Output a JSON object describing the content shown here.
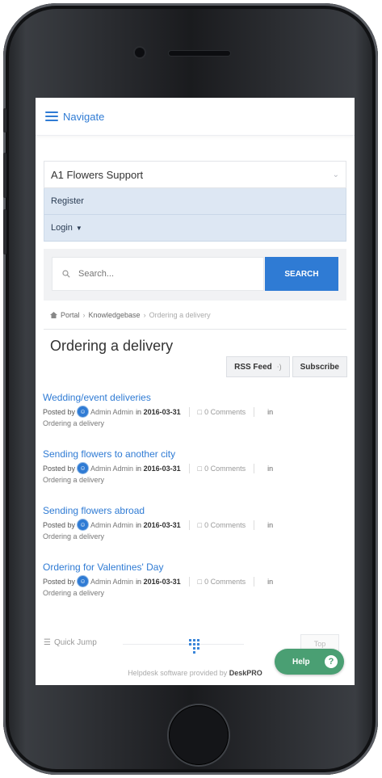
{
  "nav": {
    "label": "Navigate"
  },
  "menu": {
    "title": "A1 Flowers Support",
    "items": [
      {
        "label": "Register"
      },
      {
        "label": "Login"
      }
    ]
  },
  "search": {
    "placeholder": "Search...",
    "button_label": "SEARCH"
  },
  "breadcrumb": {
    "items": [
      "Portal",
      "Knowledgebase",
      "Ordering a delivery"
    ],
    "separator": "›"
  },
  "page": {
    "title": "Ordering a delivery"
  },
  "actions": {
    "rss_label": "RSS Feed",
    "subscribe_label": "Subscribe"
  },
  "articles": [
    {
      "title": "Wedding/event deliveries",
      "posted_by": "Posted by",
      "author": "Admin Admin",
      "in_word": "in",
      "date": "2016-03-31",
      "comments": "0 Comments",
      "in_label": "in",
      "category": "Ordering a delivery"
    },
    {
      "title": "Sending flowers to another city",
      "posted_by": "Posted by",
      "author": "Admin Admin",
      "in_word": "in",
      "date": "2016-03-31",
      "comments": "0 Comments",
      "in_label": "in",
      "category": "Ordering a delivery"
    },
    {
      "title": "Sending flowers abroad",
      "posted_by": "Posted by",
      "author": "Admin Admin",
      "in_word": "in",
      "date": "2016-03-31",
      "comments": "0 Comments",
      "in_label": "in",
      "category": "Ordering a delivery"
    },
    {
      "title": "Ordering for Valentines' Day",
      "posted_by": "Posted by",
      "author": "Admin Admin",
      "in_word": "in",
      "date": "2016-03-31",
      "comments": "0 Comments",
      "in_label": "in",
      "category": "Ordering a delivery"
    }
  ],
  "footer": {
    "quick_jump": "Quick Jump",
    "top_label": "Top",
    "powered_prefix": "Helpdesk software provided by",
    "powered_brand": "DeskPRO"
  },
  "help": {
    "label": "Help",
    "icon": "?"
  },
  "colors": {
    "accent": "#2f7bd4",
    "help_green": "#4a9f73",
    "menu_bg": "#dde7f3"
  },
  "icons": [
    "hamburger-icon",
    "chevron-down-icon",
    "search-icon",
    "home-icon",
    "rss-icon",
    "avatar-icon",
    "comment-icon",
    "list-icon",
    "grid-icon",
    "question-icon"
  ]
}
